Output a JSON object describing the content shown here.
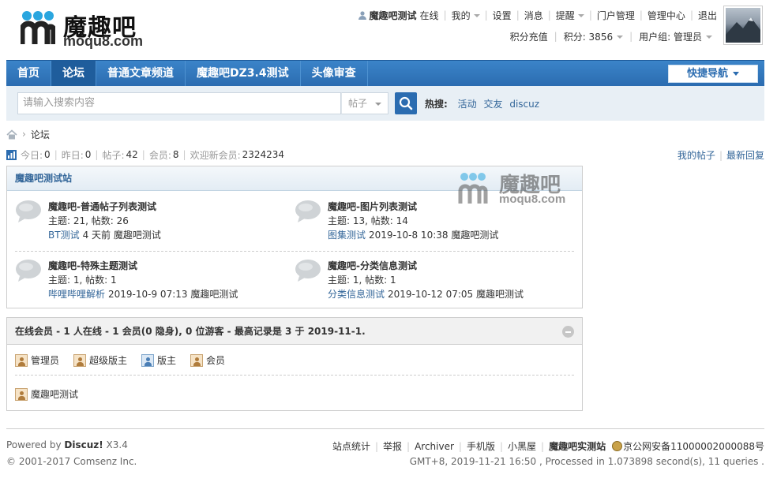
{
  "logo": {
    "brand": "魔趣吧",
    "domain": "moqu8.com"
  },
  "userbar": {
    "username": "魔趣吧测试",
    "status": "在线",
    "items": [
      "我的",
      "设置",
      "消息",
      "提醒",
      "门户管理",
      "管理中心",
      "退出"
    ]
  },
  "userbar2": {
    "recharge": "积分充值",
    "points_label": "积分: 3856",
    "group_label": "用户组: 管理员"
  },
  "nav": {
    "items": [
      "首页",
      "论坛",
      "普通文章频道",
      "魔趣吧DZ3.4测试",
      "头像审查"
    ],
    "active": "论坛",
    "quick_nav": "快捷导航"
  },
  "search": {
    "placeholder": "请输入搜索内容",
    "type": "帖子",
    "hot_label": "热搜:",
    "hot_items": [
      "活动",
      "交友",
      "discuz"
    ]
  },
  "breadcrumb": {
    "current": "论坛"
  },
  "stats": {
    "today_label": "今日:",
    "today": "0",
    "yesterday_label": "昨日:",
    "yesterday": "0",
    "posts_label": "帖子:",
    "posts": "42",
    "members_label": "会员:",
    "members": "8",
    "welcome_label": "欢迎新会员:",
    "welcome": "2324234"
  },
  "toplinks": {
    "my_posts": "我的帖子",
    "latest": "最新回复"
  },
  "forum_group": {
    "title": "魔趣吧测试站",
    "watermark_brand": "魔趣吧",
    "watermark_domain": "moqu8.com",
    "forums": [
      {
        "name": "魔趣吧-普通帖子列表测试",
        "counts": "主题: 21, 帖数: 26",
        "last_link": "BT测试",
        "last_time": "4 天前",
        "last_user": "魔趣吧测试"
      },
      {
        "name": "魔趣吧-图片列表测试",
        "counts": "主题: 13, 帖数: 14",
        "last_link": "图集测试",
        "last_time": "2019-10-8 10:38",
        "last_user": "魔趣吧测试"
      },
      {
        "name": "魔趣吧-特殊主题测试",
        "counts": "主题: 1, 帖数: 1",
        "last_link": "哔哩哔哩解析",
        "last_time": "2019-10-9 07:13",
        "last_user": "魔趣吧测试"
      },
      {
        "name": "魔趣吧-分类信息测试",
        "counts": "主题: 1, 帖数: 1",
        "last_link": "分类信息测试",
        "last_time": "2019-10-12 07:05",
        "last_user": "魔趣吧测试"
      }
    ]
  },
  "online": {
    "title": "在线会员 - 1 人在线 - 1 会员(0 隐身), 0 位游客 - 最高记录是 3 于 2019-11-1.",
    "legend": [
      "管理员",
      "超级版主",
      "版主",
      "会员"
    ],
    "users": [
      "魔趣吧测试"
    ]
  },
  "footer": {
    "powered_prefix": "Powered by ",
    "powered_name": "Discuz!",
    "powered_version": " X3.4",
    "copyright": "© 2001-2017 Comsenz Inc.",
    "links": [
      "站点统计",
      "举报",
      "Archiver",
      "手机版",
      "小黑屋",
      "魔趣吧实测站"
    ],
    "police": "京公网安备11000002000088号",
    "runtime": "GMT+8, 2019-11-21 16:50 , Processed in 1.073898 second(s), 11 queries ."
  },
  "colors": {
    "nav": "#2b6cb0",
    "link": "#336699",
    "searchbar": "#e8eff5"
  }
}
